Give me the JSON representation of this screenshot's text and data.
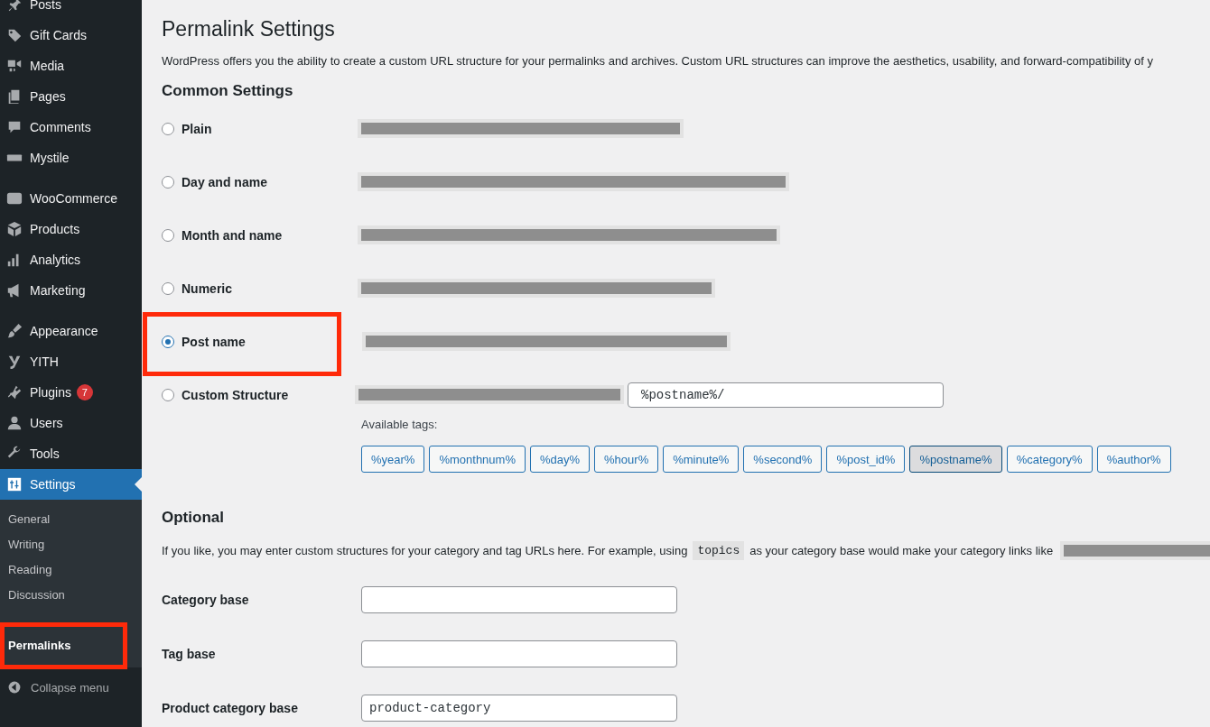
{
  "sidebar": {
    "items": [
      {
        "label": "Posts",
        "current": false,
        "gap_after": false
      },
      {
        "label": "Gift Cards",
        "current": false,
        "gap_after": false
      },
      {
        "label": "Media",
        "current": false,
        "gap_after": false
      },
      {
        "label": "Pages",
        "current": false,
        "gap_after": false
      },
      {
        "label": "Comments",
        "current": false,
        "gap_after": false
      },
      {
        "label": "Mystile",
        "current": false,
        "gap_after": true
      },
      {
        "label": "WooCommerce",
        "current": false,
        "gap_after": false
      },
      {
        "label": "Products",
        "current": false,
        "gap_after": false
      },
      {
        "label": "Analytics",
        "current": false,
        "gap_after": false
      },
      {
        "label": "Marketing",
        "current": false,
        "gap_after": true
      },
      {
        "label": "Appearance",
        "current": false,
        "gap_after": false
      },
      {
        "label": "YITH",
        "current": false,
        "gap_after": false
      },
      {
        "label": "Plugins",
        "current": false,
        "gap_after": false,
        "badge": "7"
      },
      {
        "label": "Users",
        "current": false,
        "gap_after": false
      },
      {
        "label": "Tools",
        "current": false,
        "gap_after": false
      },
      {
        "label": "Settings",
        "current": true,
        "gap_after": false
      }
    ],
    "submenu": [
      {
        "label": "General",
        "selected": false,
        "annotated": false
      },
      {
        "label": "Writing",
        "selected": false,
        "annotated": false
      },
      {
        "label": "Reading",
        "selected": false,
        "annotated": false
      },
      {
        "label": "Discussion",
        "selected": false,
        "annotated": false
      },
      {
        "label": "Permalinks",
        "selected": true,
        "annotated": true
      }
    ],
    "collapse": "Collapse menu"
  },
  "page": {
    "title": "Permalink Settings",
    "intro": "WordPress offers you the ability to create a custom URL structure for your permalinks and archives. Custom URL structures can improve the aesthetics, usability, and forward-compatibility of y",
    "common_heading": "Common Settings",
    "options": [
      {
        "label": "Plain",
        "selected": false,
        "annotated": false
      },
      {
        "label": "Day and name",
        "selected": false,
        "annotated": false
      },
      {
        "label": "Month and name",
        "selected": false,
        "annotated": false
      },
      {
        "label": "Numeric",
        "selected": false,
        "annotated": false
      },
      {
        "label": "Post name",
        "selected": true,
        "annotated": true
      },
      {
        "label": "Custom Structure",
        "selected": false,
        "annotated": false,
        "value": "%postname%/"
      }
    ],
    "tags_label": "Available tags:",
    "tags": [
      {
        "label": "%year%",
        "selected": false
      },
      {
        "label": "%monthnum%",
        "selected": false
      },
      {
        "label": "%day%",
        "selected": false
      },
      {
        "label": "%hour%",
        "selected": false
      },
      {
        "label": "%minute%",
        "selected": false
      },
      {
        "label": "%second%",
        "selected": false
      },
      {
        "label": "%post_id%",
        "selected": false
      },
      {
        "label": "%postname%",
        "selected": true
      },
      {
        "label": "%category%",
        "selected": false
      },
      {
        "label": "%author%",
        "selected": false
      }
    ],
    "optional_heading": "Optional",
    "optional_text_before": "If you like, you may enter custom structures for your category and tag URLs here. For example, using",
    "optional_code": "topics",
    "optional_text_after": "as your category base would make your category links like",
    "fields": [
      {
        "label": "Category base"
      },
      {
        "label": "Tag base"
      },
      {
        "label": "Product category base",
        "value": "product-category"
      }
    ]
  }
}
